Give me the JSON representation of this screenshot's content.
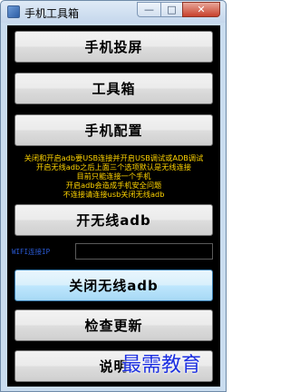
{
  "window": {
    "title": "手机工具箱",
    "controls": {
      "minimize": "—",
      "maximize": "□",
      "close": "✕"
    }
  },
  "buttons": {
    "screen_mirror": "手机投屏",
    "toolbox": "工具箱",
    "phone_config": "手机配置",
    "enable_wireless_adb": "开无线adb",
    "disable_wireless_adb": "关闭无线adb",
    "check_update": "检查更新",
    "about": "说明"
  },
  "notice_lines": [
    "关闭和开启adb要USB连接并开启USB调试或ADB调试",
    "开启无线adb之后上面三个选项默认是无线连接",
    "目前只能连接一个手机",
    "开启adb会造成手机安全问题",
    "不连接请连接usb关闭无线adb"
  ],
  "wifi": {
    "label": "WIFI连接IP",
    "value": "",
    "placeholder": ""
  },
  "watermark": "最需教育",
  "colors": {
    "background": "#000000",
    "notice": "#ffd400",
    "wifi_label": "#2a5bd7"
  }
}
